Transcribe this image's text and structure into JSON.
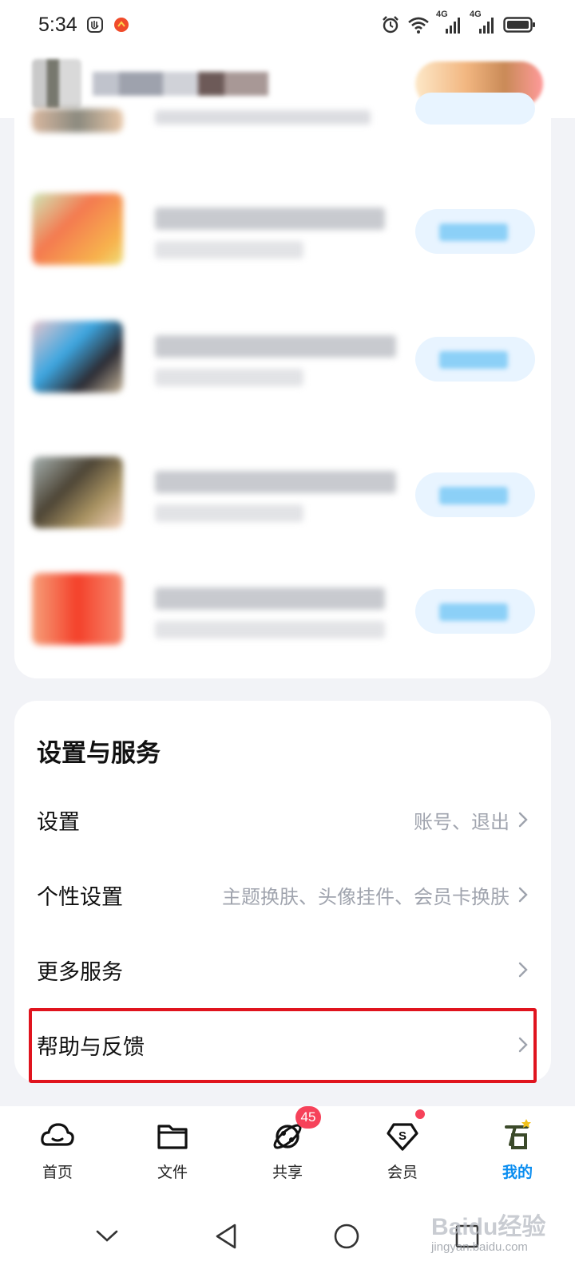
{
  "status_bar": {
    "time": "5:34",
    "network_labels": [
      "4G",
      "4G"
    ]
  },
  "settings_section": {
    "title": "设置与服务",
    "items": [
      {
        "label": "设置",
        "subtitle": "账号、退出"
      },
      {
        "label": "个性设置",
        "subtitle": "主题换肤、头像挂件、会员卡换肤"
      },
      {
        "label": "更多服务",
        "subtitle": ""
      },
      {
        "label": "帮助与反馈",
        "subtitle": ""
      }
    ]
  },
  "tab_bar": {
    "tabs": [
      {
        "label": "首页",
        "icon": "cloud-home-icon"
      },
      {
        "label": "文件",
        "icon": "folder-icon"
      },
      {
        "label": "共享",
        "icon": "share-orbit-icon",
        "badge": "45"
      },
      {
        "label": "会员",
        "icon": "vip-s-icon"
      },
      {
        "label": "我的",
        "icon": "profile-avatar-icon"
      }
    ],
    "active_index": 4
  },
  "watermark": {
    "main": "Baidu经验",
    "sub": "jingyan.baidu.com"
  },
  "colors": {
    "accent": "#0a8df0",
    "badge": "#f6425a",
    "highlight_border": "#e0141e",
    "background": "#f2f3f7"
  }
}
